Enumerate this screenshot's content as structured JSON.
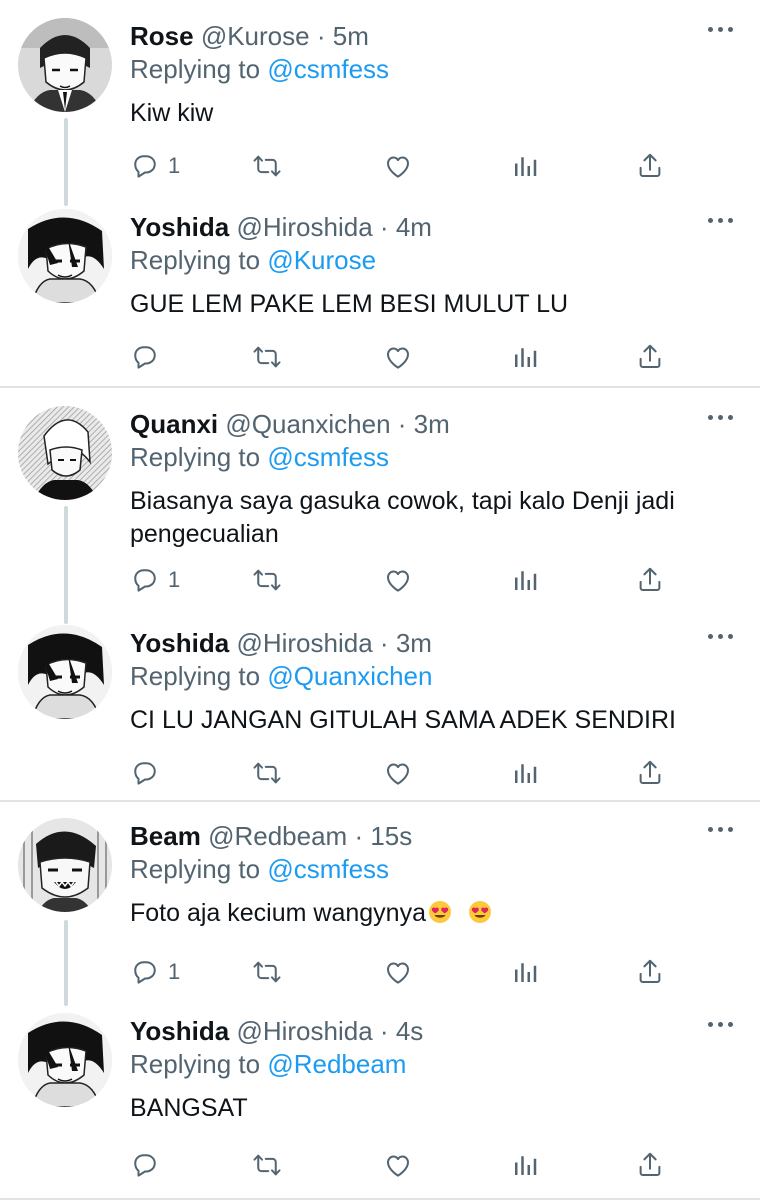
{
  "threads": [
    {
      "tweets": [
        {
          "name": "Rose",
          "handle": "@Kurose",
          "dot": "·",
          "time": "5m",
          "replying_label": "Replying to",
          "mention": "@csmfess",
          "text": "Kiw kiw",
          "reply_count": "1",
          "retweet_count": "",
          "like_count": "",
          "avatar_icon": "manga-girl-avatar"
        },
        {
          "name": "Yoshida",
          "handle": "@Hiroshida",
          "dot": "·",
          "time": "4m",
          "replying_label": "Replying to",
          "mention": "@Kurose",
          "text": "GUE LEM PAKE LEM BESI MULUT LU",
          "reply_count": "",
          "retweet_count": "",
          "like_count": "",
          "avatar_icon": "manga-boy-avatar"
        }
      ]
    },
    {
      "tweets": [
        {
          "name": "Quanxi",
          "handle": "@Quanxichen",
          "dot": "·",
          "time": "3m",
          "replying_label": "Replying to",
          "mention": "@csmfess",
          "text": "Biasanya saya gasuka cowok, tapi kalo Denji jadi pengecualian",
          "reply_count": "1",
          "retweet_count": "",
          "like_count": "",
          "avatar_icon": "manga-white-hair-avatar"
        },
        {
          "name": "Yoshida",
          "handle": "@Hiroshida",
          "dot": "·",
          "time": "3m",
          "replying_label": "Replying to",
          "mention": "@Quanxichen",
          "text": "CI LU JANGAN GITULAH SAMA ADEK SENDIRI",
          "reply_count": "",
          "retweet_count": "",
          "like_count": "",
          "avatar_icon": "manga-boy-avatar"
        }
      ]
    },
    {
      "tweets": [
        {
          "name": "Beam",
          "handle": "@Redbeam",
          "dot": "·",
          "time": "15s",
          "replying_label": "Replying to",
          "mention": "@csmfess",
          "text": "Foto aja kecium wangynya",
          "text_emoji": "heart-eyes-emoji",
          "reply_count": "1",
          "retweet_count": "",
          "like_count": "",
          "avatar_icon": "manga-sharp-teeth-avatar"
        },
        {
          "name": "Yoshida",
          "handle": "@Hiroshida",
          "dot": "·",
          "time": "4s",
          "replying_label": "Replying to",
          "mention": "@Redbeam",
          "text": "BANGSAT",
          "reply_count": "",
          "retweet_count": "",
          "like_count": "",
          "avatar_icon": "manga-boy-avatar"
        }
      ]
    }
  ],
  "colors": {
    "text": "#0f1419",
    "secondary": "#536471",
    "mention": "#1d9bf0",
    "divider": "#dfe3e6",
    "thread_line": "#cfd9de"
  }
}
